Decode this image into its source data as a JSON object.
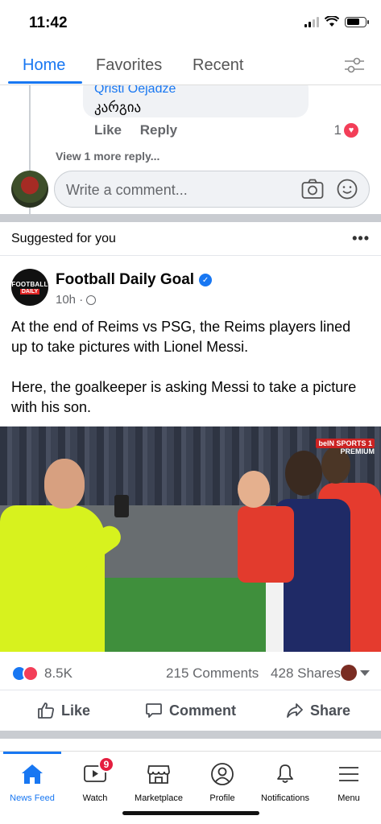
{
  "status_bar": {
    "time": "11:42"
  },
  "top_tabs": {
    "home": "Home",
    "favorites": "Favorites",
    "recent": "Recent"
  },
  "comment": {
    "author": "Qristi Oejadze",
    "text": "კარგია",
    "like": "Like",
    "reply": "Reply",
    "reaction_count": "1",
    "view_more": "View 1 more reply..."
  },
  "composer": {
    "placeholder": "Write a comment..."
  },
  "suggested": {
    "label": "Suggested for you"
  },
  "post": {
    "page_name": "Football Daily Goal",
    "avatar_line1": "FOOTBALL",
    "avatar_line2": "DAILY",
    "time": "10h ·",
    "text_p1": "At the end of Reims vs PSG, the Reims players lined up to take pictures with Lionel Messi.",
    "text_p2": "Here, the goalkeeper is asking Messi to take a picture with his son.",
    "image_overlay": "beIN SPORTS 1",
    "image_overlay2": "PREMIUM",
    "reactions_count": "8.5K",
    "comments": "215 Comments",
    "shares": "428 Shares",
    "like_label": "Like",
    "comment_label": "Comment",
    "share_label": "Share"
  },
  "bottom_nav": {
    "items": [
      "News Feed",
      "Watch",
      "Marketplace",
      "Profile",
      "Notifications",
      "Menu"
    ],
    "watch_badge": "9"
  },
  "colors": {
    "accent": "#1877f2",
    "love": "#f33e58",
    "badge": "#e41e3f"
  }
}
